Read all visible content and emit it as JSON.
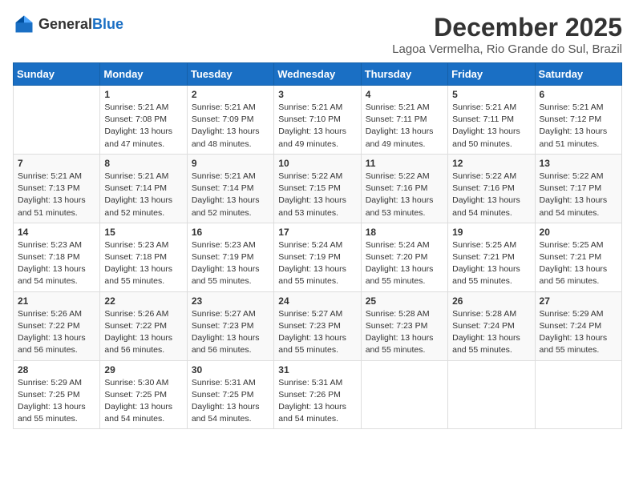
{
  "header": {
    "logo_general": "General",
    "logo_blue": "Blue",
    "month_title": "December 2025",
    "location": "Lagoa Vermelha, Rio Grande do Sul, Brazil"
  },
  "days_of_week": [
    "Sunday",
    "Monday",
    "Tuesday",
    "Wednesday",
    "Thursday",
    "Friday",
    "Saturday"
  ],
  "weeks": [
    [
      {
        "day": "",
        "info": ""
      },
      {
        "day": "1",
        "info": "Sunrise: 5:21 AM\nSunset: 7:08 PM\nDaylight: 13 hours\nand 47 minutes."
      },
      {
        "day": "2",
        "info": "Sunrise: 5:21 AM\nSunset: 7:09 PM\nDaylight: 13 hours\nand 48 minutes."
      },
      {
        "day": "3",
        "info": "Sunrise: 5:21 AM\nSunset: 7:10 PM\nDaylight: 13 hours\nand 49 minutes."
      },
      {
        "day": "4",
        "info": "Sunrise: 5:21 AM\nSunset: 7:11 PM\nDaylight: 13 hours\nand 49 minutes."
      },
      {
        "day": "5",
        "info": "Sunrise: 5:21 AM\nSunset: 7:11 PM\nDaylight: 13 hours\nand 50 minutes."
      },
      {
        "day": "6",
        "info": "Sunrise: 5:21 AM\nSunset: 7:12 PM\nDaylight: 13 hours\nand 51 minutes."
      }
    ],
    [
      {
        "day": "7",
        "info": "Sunrise: 5:21 AM\nSunset: 7:13 PM\nDaylight: 13 hours\nand 51 minutes."
      },
      {
        "day": "8",
        "info": "Sunrise: 5:21 AM\nSunset: 7:14 PM\nDaylight: 13 hours\nand 52 minutes."
      },
      {
        "day": "9",
        "info": "Sunrise: 5:21 AM\nSunset: 7:14 PM\nDaylight: 13 hours\nand 52 minutes."
      },
      {
        "day": "10",
        "info": "Sunrise: 5:22 AM\nSunset: 7:15 PM\nDaylight: 13 hours\nand 53 minutes."
      },
      {
        "day": "11",
        "info": "Sunrise: 5:22 AM\nSunset: 7:16 PM\nDaylight: 13 hours\nand 53 minutes."
      },
      {
        "day": "12",
        "info": "Sunrise: 5:22 AM\nSunset: 7:16 PM\nDaylight: 13 hours\nand 54 minutes."
      },
      {
        "day": "13",
        "info": "Sunrise: 5:22 AM\nSunset: 7:17 PM\nDaylight: 13 hours\nand 54 minutes."
      }
    ],
    [
      {
        "day": "14",
        "info": "Sunrise: 5:23 AM\nSunset: 7:18 PM\nDaylight: 13 hours\nand 54 minutes."
      },
      {
        "day": "15",
        "info": "Sunrise: 5:23 AM\nSunset: 7:18 PM\nDaylight: 13 hours\nand 55 minutes."
      },
      {
        "day": "16",
        "info": "Sunrise: 5:23 AM\nSunset: 7:19 PM\nDaylight: 13 hours\nand 55 minutes."
      },
      {
        "day": "17",
        "info": "Sunrise: 5:24 AM\nSunset: 7:19 PM\nDaylight: 13 hours\nand 55 minutes."
      },
      {
        "day": "18",
        "info": "Sunrise: 5:24 AM\nSunset: 7:20 PM\nDaylight: 13 hours\nand 55 minutes."
      },
      {
        "day": "19",
        "info": "Sunrise: 5:25 AM\nSunset: 7:21 PM\nDaylight: 13 hours\nand 55 minutes."
      },
      {
        "day": "20",
        "info": "Sunrise: 5:25 AM\nSunset: 7:21 PM\nDaylight: 13 hours\nand 56 minutes."
      }
    ],
    [
      {
        "day": "21",
        "info": "Sunrise: 5:26 AM\nSunset: 7:22 PM\nDaylight: 13 hours\nand 56 minutes."
      },
      {
        "day": "22",
        "info": "Sunrise: 5:26 AM\nSunset: 7:22 PM\nDaylight: 13 hours\nand 56 minutes."
      },
      {
        "day": "23",
        "info": "Sunrise: 5:27 AM\nSunset: 7:23 PM\nDaylight: 13 hours\nand 56 minutes."
      },
      {
        "day": "24",
        "info": "Sunrise: 5:27 AM\nSunset: 7:23 PM\nDaylight: 13 hours\nand 55 minutes."
      },
      {
        "day": "25",
        "info": "Sunrise: 5:28 AM\nSunset: 7:23 PM\nDaylight: 13 hours\nand 55 minutes."
      },
      {
        "day": "26",
        "info": "Sunrise: 5:28 AM\nSunset: 7:24 PM\nDaylight: 13 hours\nand 55 minutes."
      },
      {
        "day": "27",
        "info": "Sunrise: 5:29 AM\nSunset: 7:24 PM\nDaylight: 13 hours\nand 55 minutes."
      }
    ],
    [
      {
        "day": "28",
        "info": "Sunrise: 5:29 AM\nSunset: 7:25 PM\nDaylight: 13 hours\nand 55 minutes."
      },
      {
        "day": "29",
        "info": "Sunrise: 5:30 AM\nSunset: 7:25 PM\nDaylight: 13 hours\nand 54 minutes."
      },
      {
        "day": "30",
        "info": "Sunrise: 5:31 AM\nSunset: 7:25 PM\nDaylight: 13 hours\nand 54 minutes."
      },
      {
        "day": "31",
        "info": "Sunrise: 5:31 AM\nSunset: 7:26 PM\nDaylight: 13 hours\nand 54 minutes."
      },
      {
        "day": "",
        "info": ""
      },
      {
        "day": "",
        "info": ""
      },
      {
        "day": "",
        "info": ""
      }
    ]
  ]
}
